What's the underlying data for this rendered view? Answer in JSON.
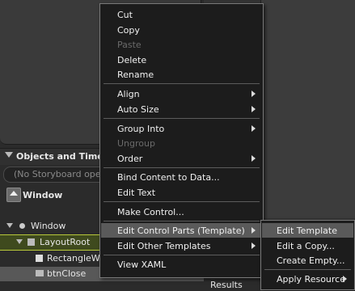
{
  "panels": {
    "objects_timeline_label": "Objects and Timeline",
    "storyboard_placeholder": "(No Storyboard open)",
    "scope_label": "Window",
    "results_label": "Results"
  },
  "tree": {
    "window": "Window",
    "layout_root": "LayoutRoot",
    "rectangle": "RectangleWin",
    "btn_close": "btnClose"
  },
  "context_menu": {
    "cut": "Cut",
    "copy": "Copy",
    "paste": "Paste",
    "delete": "Delete",
    "rename": "Rename",
    "align": "Align",
    "auto_size": "Auto Size",
    "group_into": "Group Into",
    "ungroup": "Ungroup",
    "order": "Order",
    "bind_content": "Bind Content to Data...",
    "edit_text": "Edit Text",
    "make_control": "Make Control...",
    "edit_control_parts": "Edit Control Parts (Template)",
    "edit_other_templates": "Edit Other Templates",
    "view_xaml": "View XAML"
  },
  "submenu": {
    "edit_template": "Edit Template",
    "edit_copy": "Edit a Copy...",
    "create_empty": "Create Empty...",
    "apply_resource": "Apply Resource"
  }
}
